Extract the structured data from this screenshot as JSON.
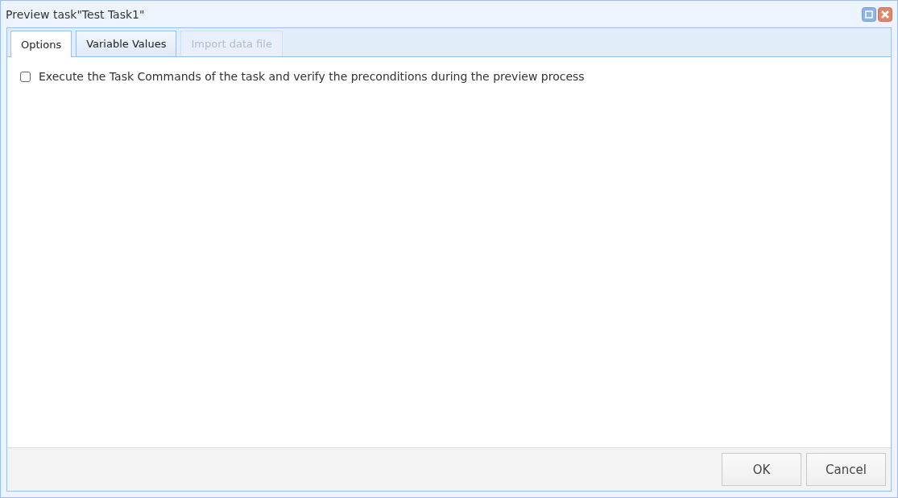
{
  "window": {
    "title": "Preview task\"Test Task1\""
  },
  "tabs": [
    {
      "label": "Options",
      "selected": true,
      "disabled": false
    },
    {
      "label": "Variable Values",
      "selected": false,
      "disabled": false
    },
    {
      "label": "Import data file",
      "selected": false,
      "disabled": true
    }
  ],
  "option": {
    "label": "Execute the Task Commands of the task and verify the preconditions during the preview process",
    "checked": false
  },
  "buttons": [
    "OK",
    "Cancel"
  ]
}
